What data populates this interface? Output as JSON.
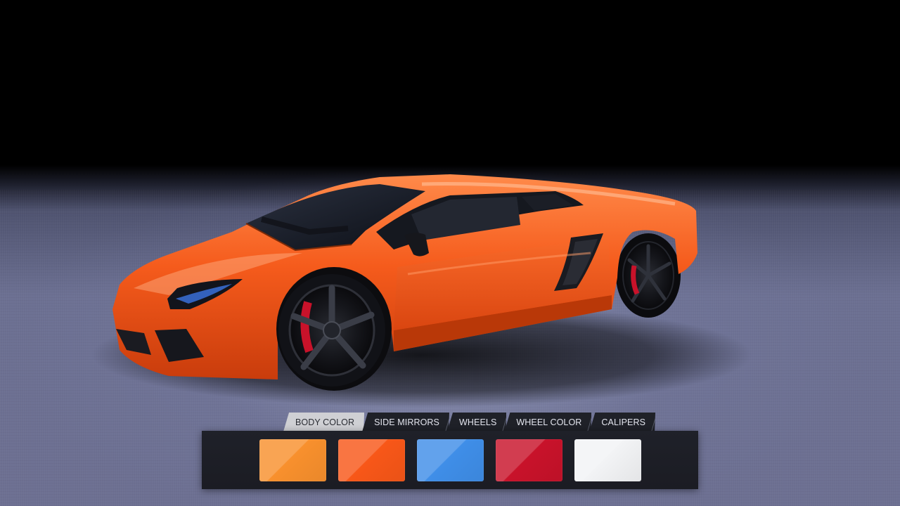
{
  "configurator": {
    "tabs": [
      {
        "label": "BODY COLOR",
        "active": true
      },
      {
        "label": "SIDE MIRRORS",
        "active": false
      },
      {
        "label": "WHEELS",
        "active": false
      },
      {
        "label": "WHEEL COLOR",
        "active": false
      },
      {
        "label": "CALIPERS",
        "active": false
      }
    ],
    "swatches": [
      {
        "name": "orange-light",
        "color": "#f8902d"
      },
      {
        "name": "orange",
        "color": "#f85718"
      },
      {
        "name": "blue",
        "color": "#3f8ee8"
      },
      {
        "name": "red",
        "color": "#c8122a"
      },
      {
        "name": "white",
        "color": "#f2f3f5"
      }
    ]
  },
  "vehicle": {
    "body_color": "#f55b1c",
    "caliper_color": "#c8122a"
  }
}
